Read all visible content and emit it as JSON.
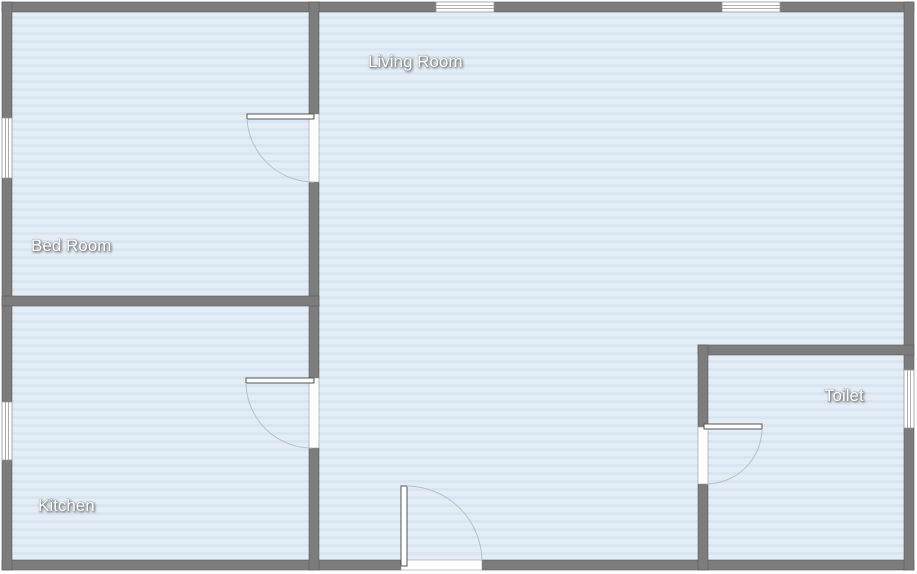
{
  "rooms": {
    "living_room": "Living Room",
    "bed_room": "Bed Room",
    "kitchen": "Kitchen",
    "toilet": "Toilet"
  },
  "colors": {
    "wall": "#7c7c7c",
    "wall_edge": "#5a5a5a",
    "floor": "#e4edf5",
    "floor_stripe": "#d6e3ee",
    "door_leaf": "#ffffff",
    "door_swing": "#b7c1c9"
  }
}
